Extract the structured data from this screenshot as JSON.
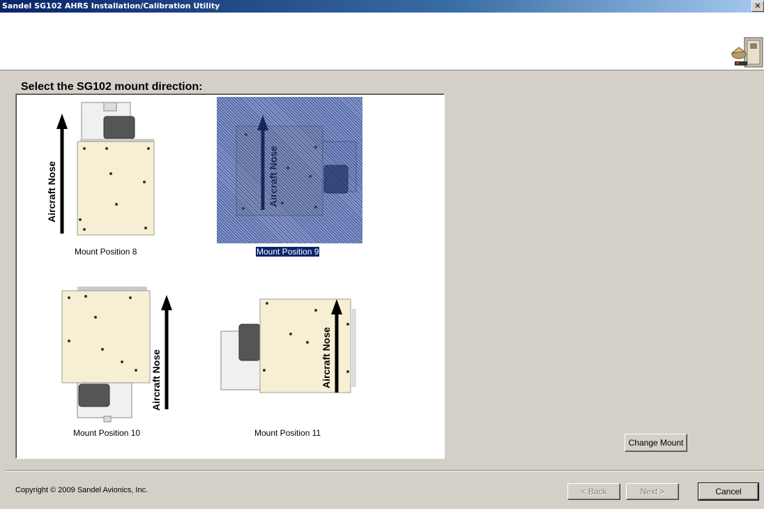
{
  "window": {
    "title": "Sandel SG102 AHRS Installation/Calibration Utility",
    "close_glyph": "✕"
  },
  "main": {
    "heading": "Select the SG102 mount direction:",
    "arrow_label": "Aircraft Nose",
    "tiles": [
      {
        "label": "Mount Position 8",
        "selected": false
      },
      {
        "label": "Mount Position 9",
        "selected": true
      },
      {
        "label": "Mount Position 10",
        "selected": false
      },
      {
        "label": "Mount Position 11",
        "selected": false
      }
    ],
    "change_mount_label": "Change Mount"
  },
  "footer": {
    "copyright": "Copyright © 2009 Sandel Avionics, Inc.",
    "back_label": "< Back",
    "next_label": "Next >",
    "cancel_label": "Cancel"
  },
  "colors": {
    "title_bar": "#0a246a",
    "unit_body": "#f7efd3",
    "selection": "#0a246a",
    "window_bg": "#d4d0c8"
  },
  "icons": {
    "app_logo": "ahrs-device-icon",
    "close": "close-icon",
    "arrow": "nose-arrow-icon"
  }
}
